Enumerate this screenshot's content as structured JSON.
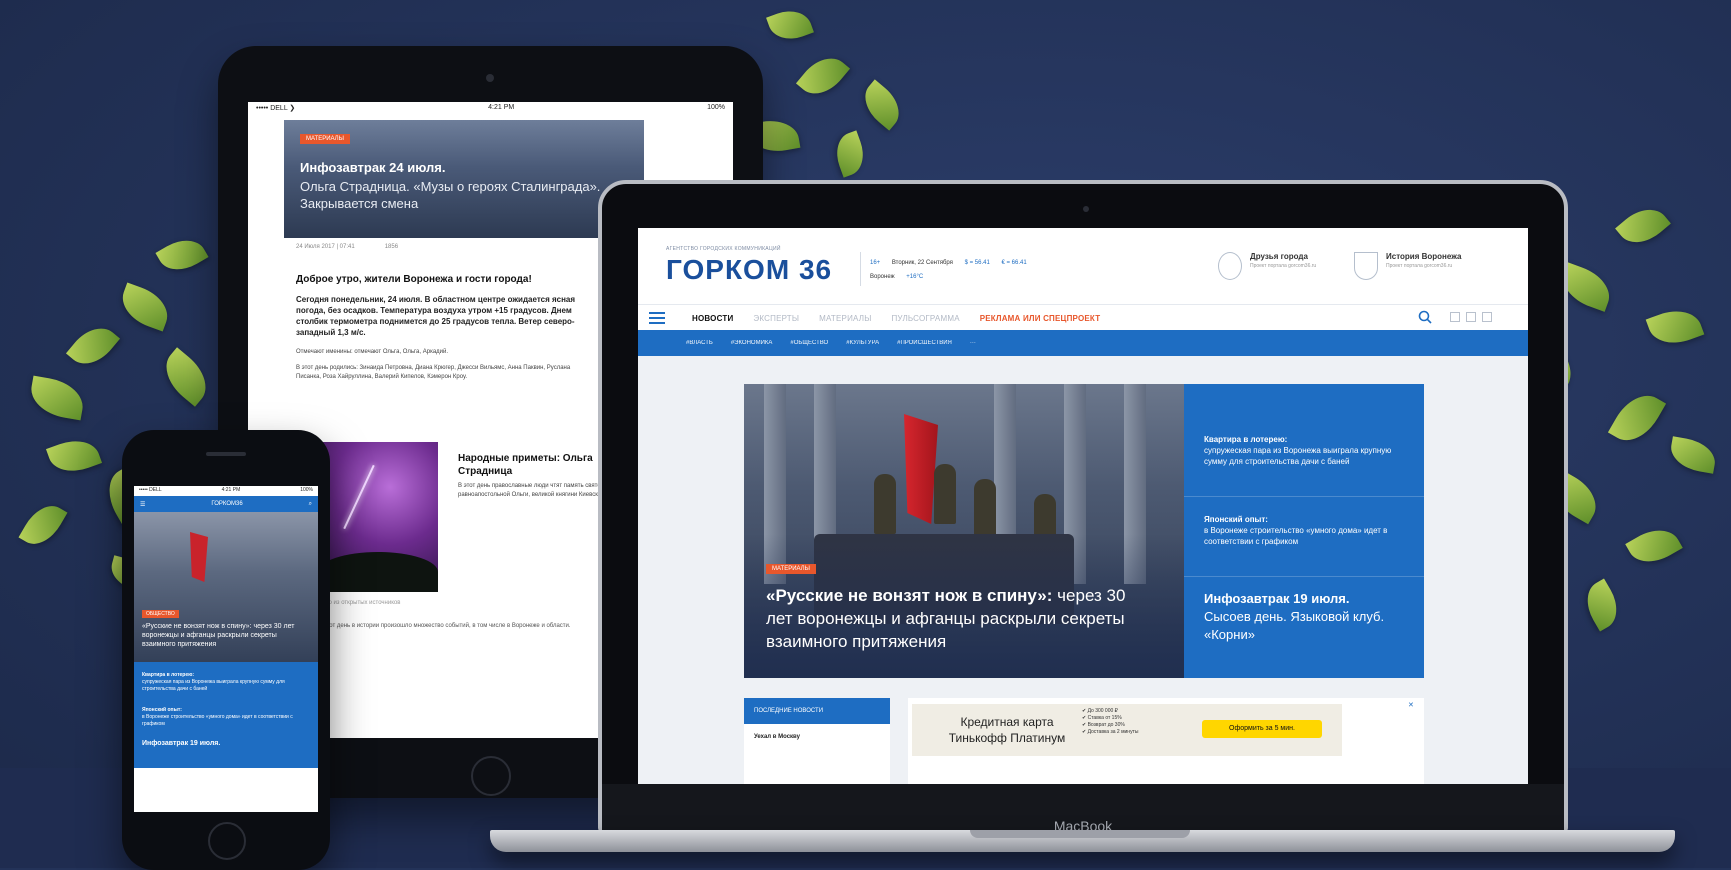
{
  "tablet": {
    "status_left": "••••• DELL ❯",
    "status_center": "4:21 PM",
    "status_right": "100%",
    "hero_tag": "МАТЕРИАЛЫ",
    "hero_title": "Инфозавтрак 24 июля.",
    "hero_subtitle": "Ольга Страдница. «Музы о героях Сталинграда». Закрывается смена",
    "meta_date": "24 Июля 2017 | 07:41",
    "meta_views": "1856",
    "heading": "Доброе утро, жители Воронежа и гости города!",
    "paragraph": "Сегодня понедельник, 24 июля. В областном центре ожидается ясная погода, без осадков. Температура воздуха утром +15 градусов. Днем столбик термометра поднимется до 25 градусов тепла. Ветер северо-западный 1,3 м/с.",
    "small1": "Отмечают именины: отмечают Ольга, Ольга, Аркадий.",
    "small2": "В этот день родились: Зинаида Петровна, Диана Крюгер, Джесси Вильямс, Анна Паквин, Руслана Писанка, Роза Хайруллина, Валерий Кипелов, Кэмерон Кроу.",
    "side_title": "Народные приметы: Ольга Страдница",
    "side_text": "В этот день православные люди чтят память святой равноапостольной Ольги, великой княгини Киевской.",
    "caption": "Фото из открытых источников",
    "body": "В этот день в истории произошло множество событий, в том числе в Воронеже и области."
  },
  "phone": {
    "status_left": "••••• DELL",
    "status_center": "4:21 PM",
    "status_right": "100%",
    "nav_menu": "☰",
    "nav_title": "ГОРКОМ36",
    "nav_search": "⌕",
    "hero_tag": "ОБЩЕСТВО",
    "hero_title": "«Русские не вонзят нож в спину»: через 30 лет воронежцы и афганцы раскрыли секреты взаимного притяжения",
    "blue1_title": "Квартира в лотерею:",
    "blue1_text": "супружеская пара из Воронежа выиграла крупную сумму для строительства дачи с баней",
    "blue2_title": "Японский опыт:",
    "blue2_text": "в Воронеже строительство «умного дома» идет в соответствии с графиком",
    "blue3": "Инфозавтрак 19 июля."
  },
  "laptop": {
    "brand": "MacBook",
    "logo_sub": "АГЕНТСТВО ГОРОДСКИХ КОММУНИКАЦИЙ",
    "logo_text": "ГОРКОМ",
    "logo_num": "36",
    "info_age": "16+",
    "info_date": "Вторник, 22 Сентября",
    "info_usd": "$ = 56.41",
    "info_eur": "€ = 66.41",
    "info_city": "Воронеж",
    "info_weather": "+16°C",
    "card1_title": "Друзья города",
    "card1_desc": "Проект портала gorcom36.ru",
    "card2_title": "История Воронежа",
    "card2_desc": "Проект портала gorcom36.ru",
    "nav": [
      "НОВОСТИ",
      "ЭКСПЕРТЫ",
      "МАТЕРИАЛЫ",
      "ПУЛЬСОГРАММА",
      "РЕКЛАМА ИЛИ СПЕЦПРОЕКТ"
    ],
    "subnav": [
      "#ВЛАСТЬ",
      "#ЭКОНОМИКА",
      "#ОБЩЕСТВО",
      "#КУЛЬТУРА",
      "#ПРОИСШЕСТВИЯ",
      "···"
    ],
    "hero_tag": "МАТЕРИАЛЫ",
    "hero_title_bold": "«Русские не вонзят нож в спину»:",
    "hero_title_rest": "через 30 лет воронежцы и афганцы раскрыли секреты взаимного притяжения",
    "side1_title": "Квартира в лотерею:",
    "side1_text": "супружеская пара из Воронежа выиграла крупную сумму для строительства дачи с баней",
    "side2_title": "Японский опыт:",
    "side2_text": "в Воронеже строительство «умного дома» идет в соответствии с графиком",
    "side3_title": "Инфозавтрак 19 июля.",
    "side3_text": "Сысоев день. Языковой клуб. «Корни»",
    "news_header": "ПОСЛЕДНИЕ НОВОСТИ",
    "news_item": "Уехал в Москву",
    "ad_title": "Кредитная карта Тинькофф Платинум",
    "ad_list": [
      "✔ До 300 000 ₽",
      "✔ Ставка от 15%",
      "✔ Возврат до 30%",
      "✔ Доставка за 2 минуты"
    ],
    "ad_button": "Оформить за 5 мин.",
    "ad_close": "✕"
  },
  "colors": {
    "background": "#233258",
    "accent_blue": "#1e6dc2",
    "accent_orange": "#e8572c",
    "ad_button": "#ffd600"
  },
  "icons": [
    "hamburger-icon",
    "search-icon",
    "facebook-icon",
    "vk-icon",
    "odnoklassniki-icon",
    "close-icon",
    "map-icon",
    "shield-icon"
  ]
}
